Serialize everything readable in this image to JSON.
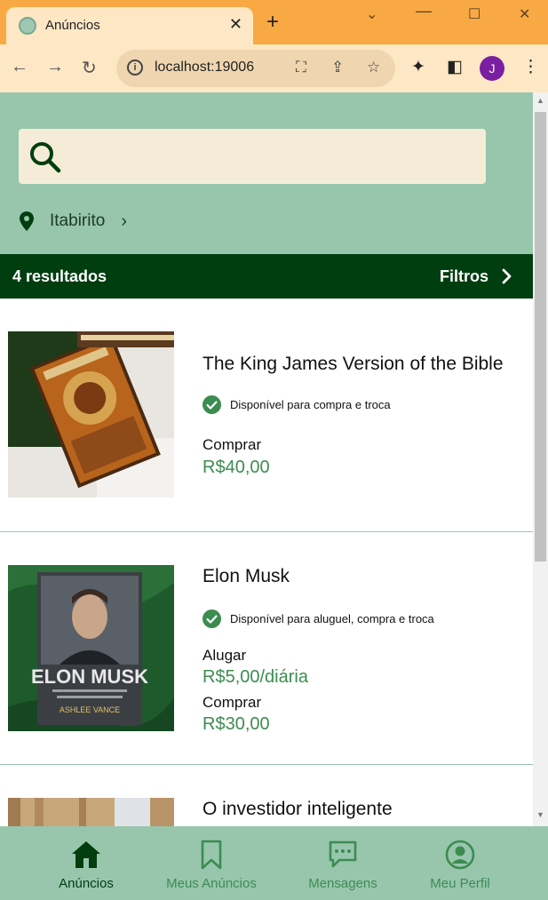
{
  "browser": {
    "tab_title": "Anúncios",
    "url": "localhost:19006",
    "profile_initial": "J"
  },
  "search": {
    "placeholder": ""
  },
  "location": {
    "city": "Itabirito"
  },
  "results": {
    "count_label": "4 resultados",
    "filters_label": "Filtros"
  },
  "listings": [
    {
      "title": "The King James Version of the Bible",
      "availability": "Disponível para compra e troca",
      "prices": [
        {
          "type": "Comprar",
          "value": "R$40,00"
        }
      ]
    },
    {
      "title": "Elon Musk",
      "availability": "Disponível para aluguel, compra e troca",
      "prices": [
        {
          "type": "Alugar",
          "value": "R$5,00/diária"
        },
        {
          "type": "Comprar",
          "value": "R$30,00"
        }
      ]
    },
    {
      "title": "O investidor inteligente"
    }
  ],
  "book_cover_text": {
    "elon_title": "ELON MUSK",
    "elon_author": "ASHLEE VANCE"
  },
  "bottom_nav": [
    {
      "label": "Anúncios",
      "icon": "home-icon",
      "active": true
    },
    {
      "label": "Meus Anúncios",
      "icon": "bookmark-icon",
      "active": false
    },
    {
      "label": "Mensagens",
      "icon": "chat-icon",
      "active": false
    },
    {
      "label": "Meu Perfil",
      "icon": "profile-icon",
      "active": false
    }
  ],
  "colors": {
    "accent_dark": "#003e0f",
    "accent_light": "#97c6ad",
    "price_green": "#3c8c50",
    "nav_inactive": "#3c8c50"
  }
}
